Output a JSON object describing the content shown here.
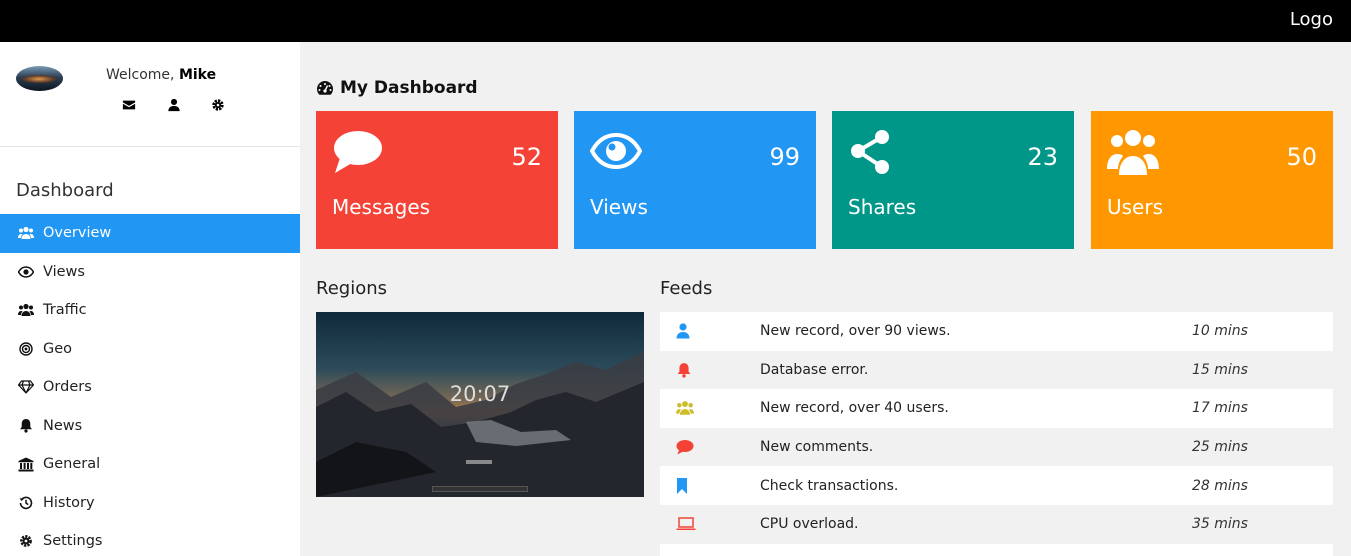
{
  "topbar": {
    "logo": "Logo"
  },
  "profile": {
    "welcome": "Welcome, ",
    "name": "Mike"
  },
  "sidebar": {
    "title": "Dashboard",
    "items": [
      {
        "label": "Overview",
        "icon": "users-icon",
        "active": true
      },
      {
        "label": "Views",
        "icon": "eye-icon"
      },
      {
        "label": "Traffic",
        "icon": "users-icon"
      },
      {
        "label": "Geo",
        "icon": "bullseye-icon"
      },
      {
        "label": "Orders",
        "icon": "diamond-icon"
      },
      {
        "label": "News",
        "icon": "bell-icon"
      },
      {
        "label": "General",
        "icon": "bank-icon"
      },
      {
        "label": "History",
        "icon": "history-icon"
      },
      {
        "label": "Settings",
        "icon": "gear-icon"
      }
    ]
  },
  "main": {
    "title": "My Dashboard",
    "cards": [
      {
        "label": "Messages",
        "value": "52",
        "color": "#f44336",
        "icon": "comment-icon"
      },
      {
        "label": "Views",
        "value": "99",
        "color": "#2196f3",
        "icon": "eye-icon"
      },
      {
        "label": "Shares",
        "value": "23",
        "color": "#009688",
        "icon": "share-icon"
      },
      {
        "label": "Users",
        "value": "50",
        "color": "#ff9800",
        "icon": "users-icon"
      }
    ],
    "regions": {
      "title": "Regions",
      "clock": "20:07"
    },
    "feeds": {
      "title": "Feeds",
      "rows": [
        {
          "text": "New record, over 90 views.",
          "time": "10 mins",
          "icon": "user-icon",
          "color": "#2196f3"
        },
        {
          "text": "Database error.",
          "time": "15 mins",
          "icon": "bell-icon",
          "color": "#f44336"
        },
        {
          "text": "New record, over 40 users.",
          "time": "17 mins",
          "icon": "users-icon",
          "color": "#cdbd2a"
        },
        {
          "text": "New comments.",
          "time": "25 mins",
          "icon": "comment-icon",
          "color": "#f44336"
        },
        {
          "text": "Check transactions.",
          "time": "28 mins",
          "icon": "bookmark-icon",
          "color": "#2196f3"
        },
        {
          "text": "CPU overload.",
          "time": "35 mins",
          "icon": "laptop-icon",
          "color": "#f44336"
        }
      ]
    }
  }
}
